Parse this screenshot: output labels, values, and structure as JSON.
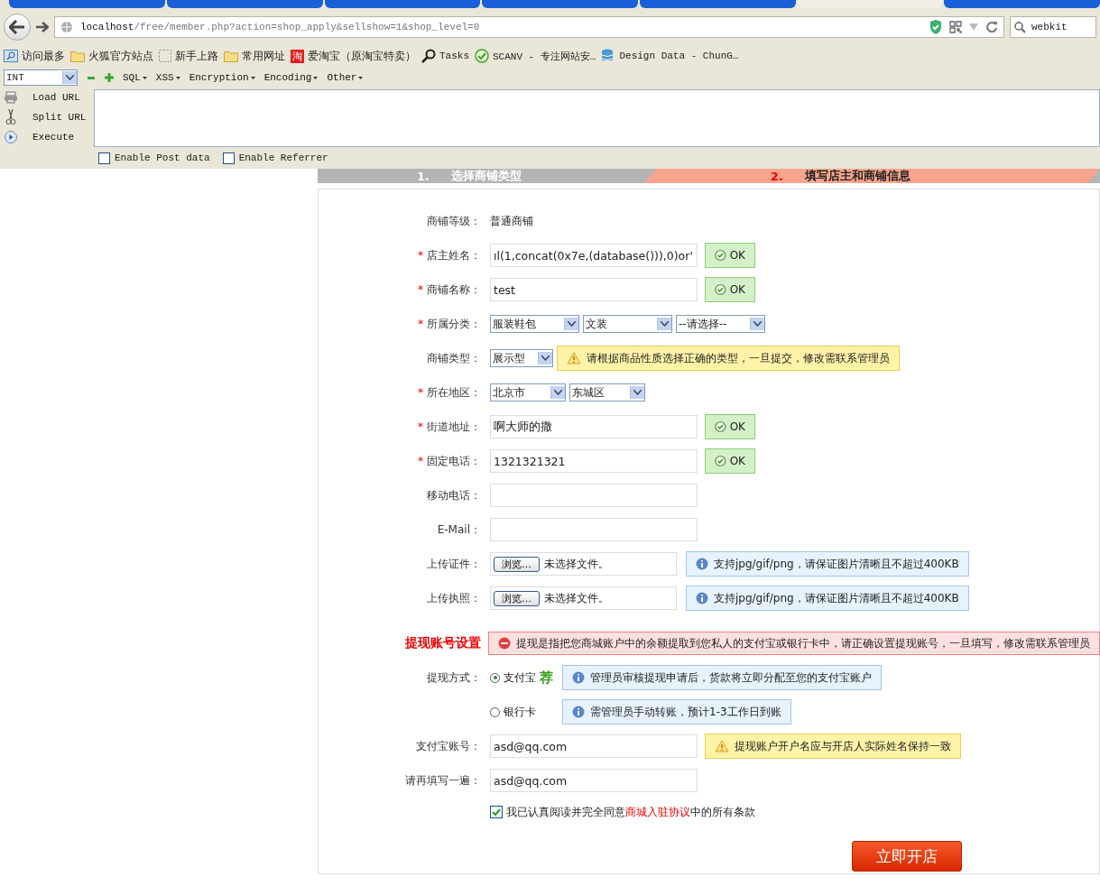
{
  "browser": {
    "tabs": [
      {
        "selected": false
      },
      {
        "selected": false
      },
      {
        "selected": false
      },
      {
        "selected": false
      },
      {
        "selected": false
      },
      {
        "selected": true
      },
      {
        "selected": false
      }
    ],
    "url": {
      "host": "localhost",
      "path": "/free/member.php?action=shop_apply&sellshow=1&shop_level=0"
    },
    "search": {
      "value": "webkit"
    },
    "bookmarks": [
      {
        "kind": "search",
        "label": "访问最多"
      },
      {
        "kind": "folder",
        "label": "火狐官方站点"
      },
      {
        "kind": "dashed",
        "label": "新手上路"
      },
      {
        "kind": "folder",
        "label": "常用网址"
      },
      {
        "kind": "taobao",
        "label": "爱淘宝（原淘宝特卖）",
        "icon_text": "淘"
      },
      {
        "kind": "magnifier",
        "label": "Tasks"
      },
      {
        "kind": "check",
        "label": "SCANV - 专注网站安…"
      },
      {
        "kind": "db",
        "label": "Design Data - ChunG…"
      }
    ]
  },
  "hackbar": {
    "type_select": "INT",
    "menus": [
      "SQL",
      "XSS",
      "Encryption",
      "Encoding",
      "Other"
    ],
    "actions": [
      {
        "kind": "load",
        "label": "Load URL"
      },
      {
        "kind": "split",
        "label": "Split URL"
      },
      {
        "kind": "execute",
        "label": "Execute"
      }
    ],
    "options": [
      {
        "label": "Enable Post data",
        "checked": false
      },
      {
        "label": "Enable Referrer",
        "checked": false
      }
    ]
  },
  "steps": [
    {
      "number": "1.",
      "label": "选择商铺类型",
      "selected": false
    },
    {
      "number": "2.",
      "label": "填写店主和商铺信息",
      "selected": true
    }
  ],
  "form": {
    "rows": [
      {
        "kind": "text",
        "label": "商铺等级：",
        "value": "普通商铺"
      },
      {
        "kind": "input",
        "required_mark": "*",
        "label": "店主姓名：",
        "value": "ıl(1,concat(0x7e,(database())),0)or'",
        "note": {
          "kind": "ok",
          "text": "OK"
        }
      },
      {
        "kind": "input",
        "required_mark": "*",
        "label": "商铺名称：",
        "value": "test",
        "note": {
          "kind": "ok",
          "text": "OK"
        }
      },
      {
        "kind": "selects",
        "required_mark": "*",
        "label": "所属分类：",
        "selects": [
          "服装鞋包",
          "文装",
          "--请选择--"
        ]
      },
      {
        "kind": "selects",
        "label": "商铺类型：",
        "selects": [
          "展示型"
        ],
        "note": {
          "kind": "warn",
          "text": "请根据商品性质选择正确的类型，一旦提交，修改需联系管理员"
        }
      },
      {
        "kind": "selects",
        "required_mark": "*",
        "label": "所在地区：",
        "selects": [
          "北京市",
          "东城区"
        ]
      },
      {
        "kind": "input",
        "required_mark": "*",
        "label": "街道地址：",
        "value": "啊大师的撒",
        "note": {
          "kind": "ok",
          "text": "OK"
        }
      },
      {
        "kind": "input",
        "required_mark": "*",
        "label": "固定电话：",
        "value": "1321321321",
        "note": {
          "kind": "ok",
          "text": "OK"
        }
      },
      {
        "kind": "input",
        "label": "移动电话："
      },
      {
        "kind": "input",
        "label": "E-Mail："
      },
      {
        "kind": "file",
        "label": "上传证件：",
        "button": "浏览…",
        "value": "未选择文件。",
        "note": {
          "kind": "info",
          "text": "支持jpg/gif/png，请保证图片清晰且不超过400KB"
        }
      },
      {
        "kind": "file",
        "label": "上传执照：",
        "button": "浏览…",
        "value": "未选择文件。",
        "note": {
          "kind": "info",
          "text": "支持jpg/gif/png，请保证图片清晰且不超过400KB"
        }
      },
      {
        "kind": "section",
        "label": "提现账号设置",
        "note": {
          "kind": "error",
          "text": "提现是指把您商城账户中的余额提取到您私人的支付宝或银行卡中，请正确设置提现账号，一旦填写，修改需联系管理员"
        }
      },
      {
        "kind": "radio",
        "label": "提现方式：",
        "option": "支付宝",
        "badge": "荐",
        "selected": true,
        "note": {
          "kind": "info",
          "text": "管理员审核提现申请后，货款将立即分配至您的支付宝账户"
        }
      },
      {
        "kind": "radio",
        "option": "银行卡",
        "selected": false,
        "note": {
          "kind": "info",
          "text": "需管理员手动转账，预计1-3工作日到账"
        }
      },
      {
        "kind": "input",
        "label": "支付宝账号：",
        "value": "asd@qq.com",
        "note": {
          "kind": "warn",
          "text": "提现账户开户名应与开店人实际姓名保持一致"
        }
      },
      {
        "kind": "input",
        "label": "请再填写一遍：",
        "value": "asd@qq.com"
      }
    ],
    "agreement": {
      "checked": true,
      "before": "我已认真阅读并完全同意",
      "link": "商城入驻协议",
      "after": "中的所有条款"
    },
    "submit": "立即开店"
  }
}
